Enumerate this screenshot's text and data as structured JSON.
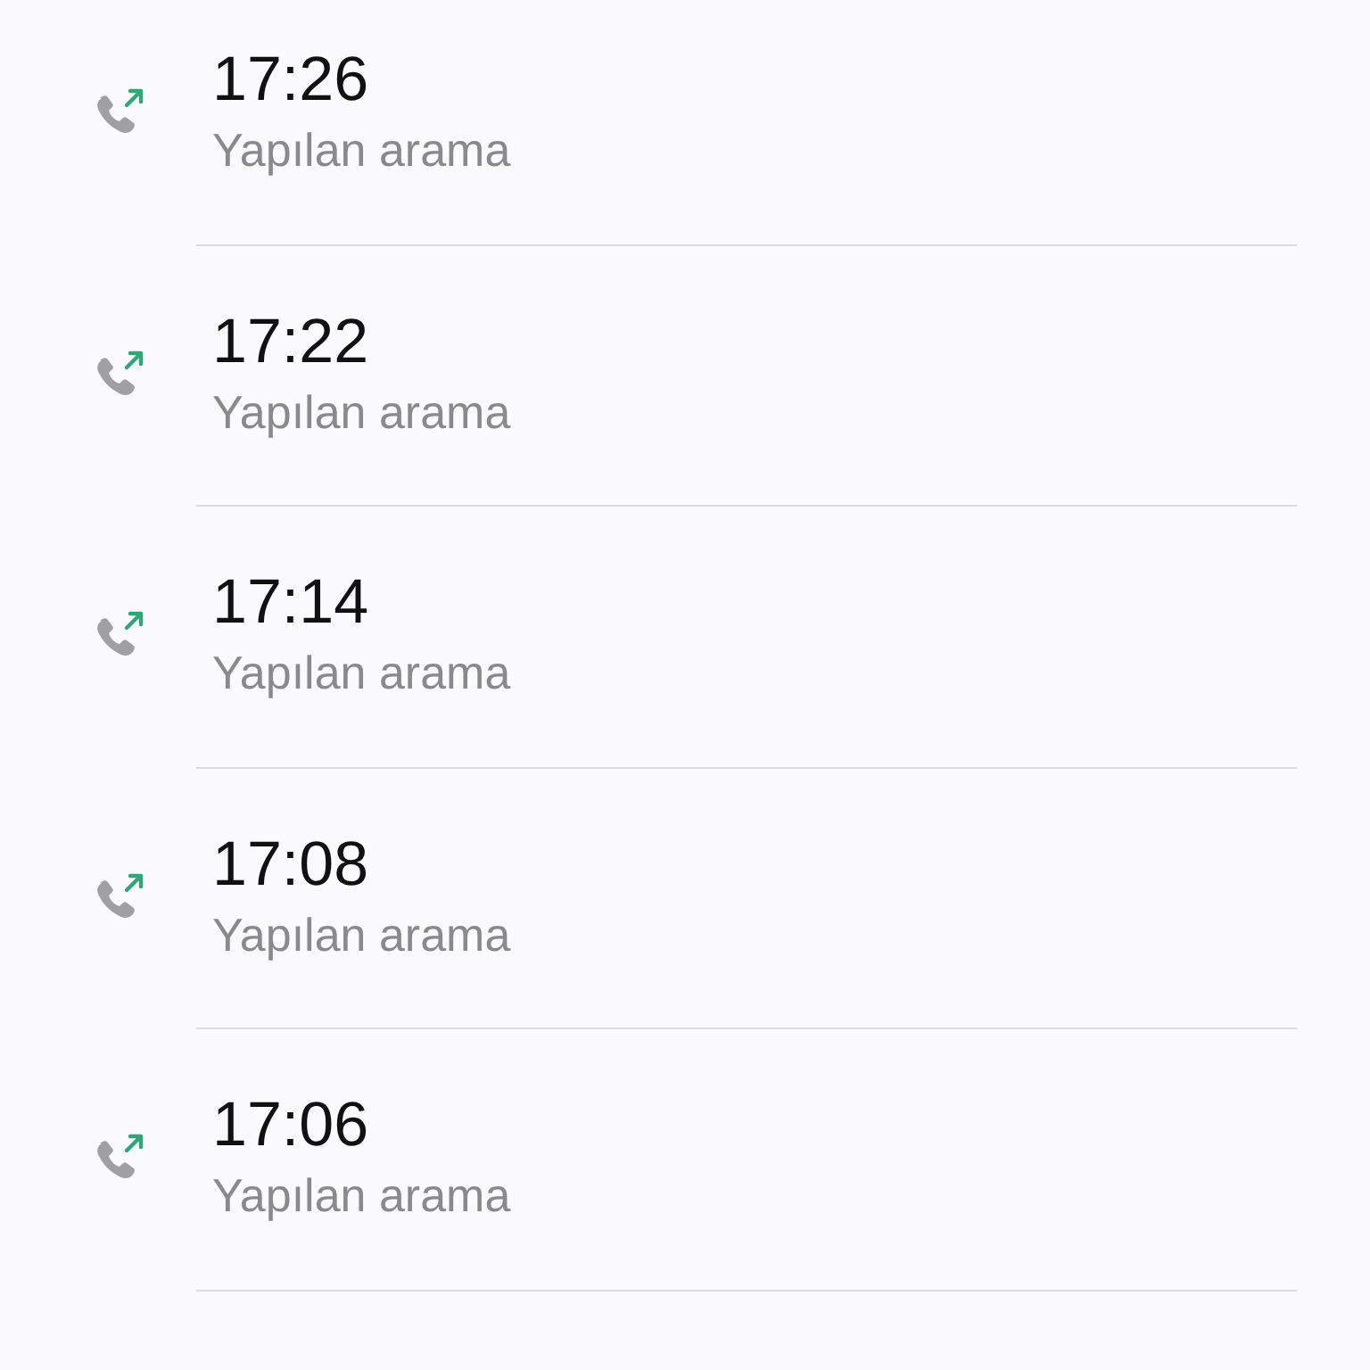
{
  "calls": [
    {
      "time": "17:26",
      "type": "Yapılan arama",
      "kind": "outgoing"
    },
    {
      "time": "17:22",
      "type": "Yapılan arama",
      "kind": "outgoing"
    },
    {
      "time": "17:14",
      "type": "Yapılan arama",
      "kind": "outgoing"
    },
    {
      "time": "17:08",
      "type": "Yapılan arama",
      "kind": "outgoing"
    },
    {
      "time": "17:06",
      "type": "Yapılan arama",
      "kind": "outgoing"
    }
  ]
}
